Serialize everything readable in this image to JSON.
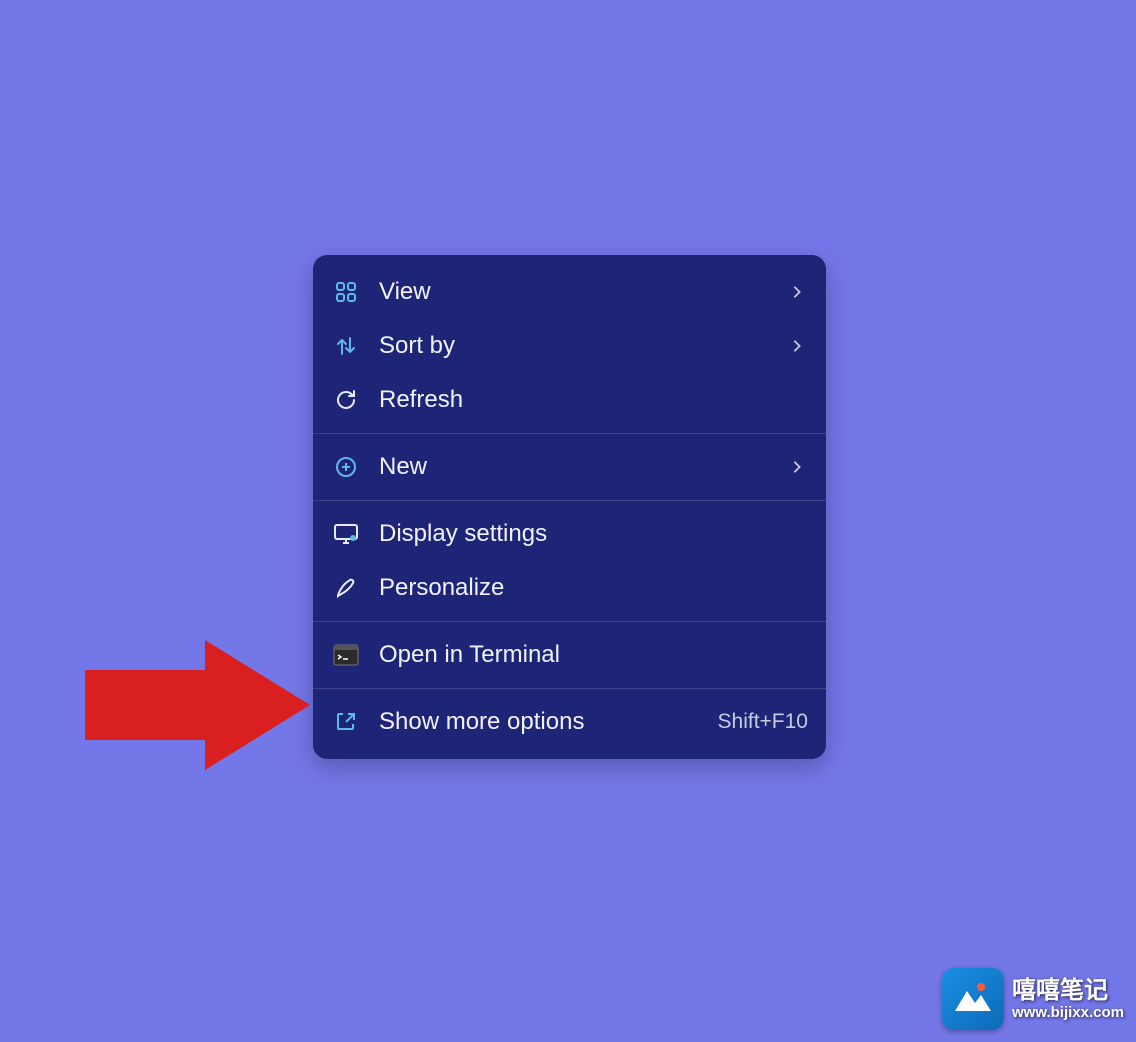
{
  "menu": {
    "items": [
      {
        "icon": "grid",
        "label": "View",
        "hasSubmenu": true
      },
      {
        "icon": "sort",
        "label": "Sort by",
        "hasSubmenu": true
      },
      {
        "icon": "refresh",
        "label": "Refresh",
        "hasSubmenu": false
      }
    ],
    "group2": [
      {
        "icon": "plus-circle",
        "label": "New",
        "hasSubmenu": true
      }
    ],
    "group3": [
      {
        "icon": "display",
        "label": "Display settings",
        "hasSubmenu": false
      },
      {
        "icon": "pen",
        "label": "Personalize",
        "hasSubmenu": false
      }
    ],
    "group4": [
      {
        "icon": "terminal",
        "label": "Open in Terminal",
        "hasSubmenu": false
      }
    ],
    "group5": [
      {
        "icon": "expand",
        "label": "Show more options",
        "accel": "Shift+F10"
      }
    ]
  },
  "watermark": {
    "title": "嘻嘻笔记",
    "url": "www.bijixx.com"
  },
  "colors": {
    "bg": "#7477e8",
    "menu": "#1f2576",
    "text": "#f1f2fb",
    "accent": "#4fc3f7",
    "arrow": "#d91f1f"
  }
}
